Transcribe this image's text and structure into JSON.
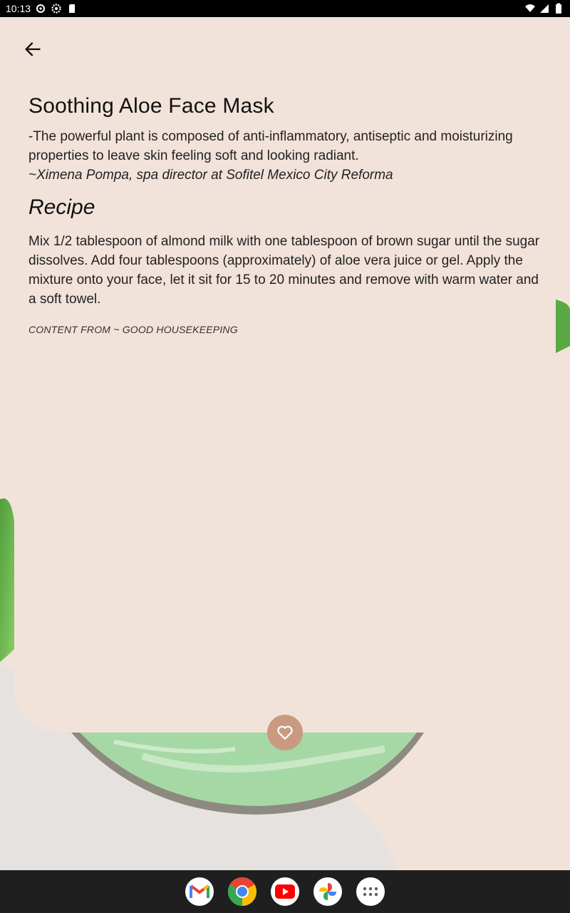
{
  "status_bar": {
    "time": "10:13",
    "icons": [
      "settings-icon",
      "settings-icon",
      "sd-card-icon",
      "wifi-icon",
      "signal-icon",
      "battery-icon"
    ]
  },
  "header": {
    "back_icon": "arrow-back-icon"
  },
  "article": {
    "title": "Soothing Aloe Face Mask",
    "quote": "-The powerful plant is composed of anti-inflammatory, antiseptic and moisturizing properties to leave skin feeling soft and looking radiant.",
    "quote_author": "~Ximena Pompa, spa director at Sofitel Mexico City Reforma",
    "recipe_heading": "Recipe",
    "recipe_body": "Mix 1/2 tablespoon of almond milk with one tablespoon of brown sugar until the sugar dissolves. Add four tablespoons (approximately) of aloe vera juice or gel. Apply the mixture onto your face, let it sit for 15 to 20 minutes and remove with warm water and a soft towel.",
    "credit": "CONTENT FROM ~ GOOD HOUSEKEEPING"
  },
  "actions": {
    "favorite_icon": "heart-icon"
  },
  "dock": {
    "apps": [
      "Gmail",
      "Chrome",
      "YouTube",
      "Photos",
      "App drawer"
    ]
  },
  "colors": {
    "background": "#f2e3da",
    "favorite_button": "#c99a80",
    "dock": "#1f1f1f"
  }
}
